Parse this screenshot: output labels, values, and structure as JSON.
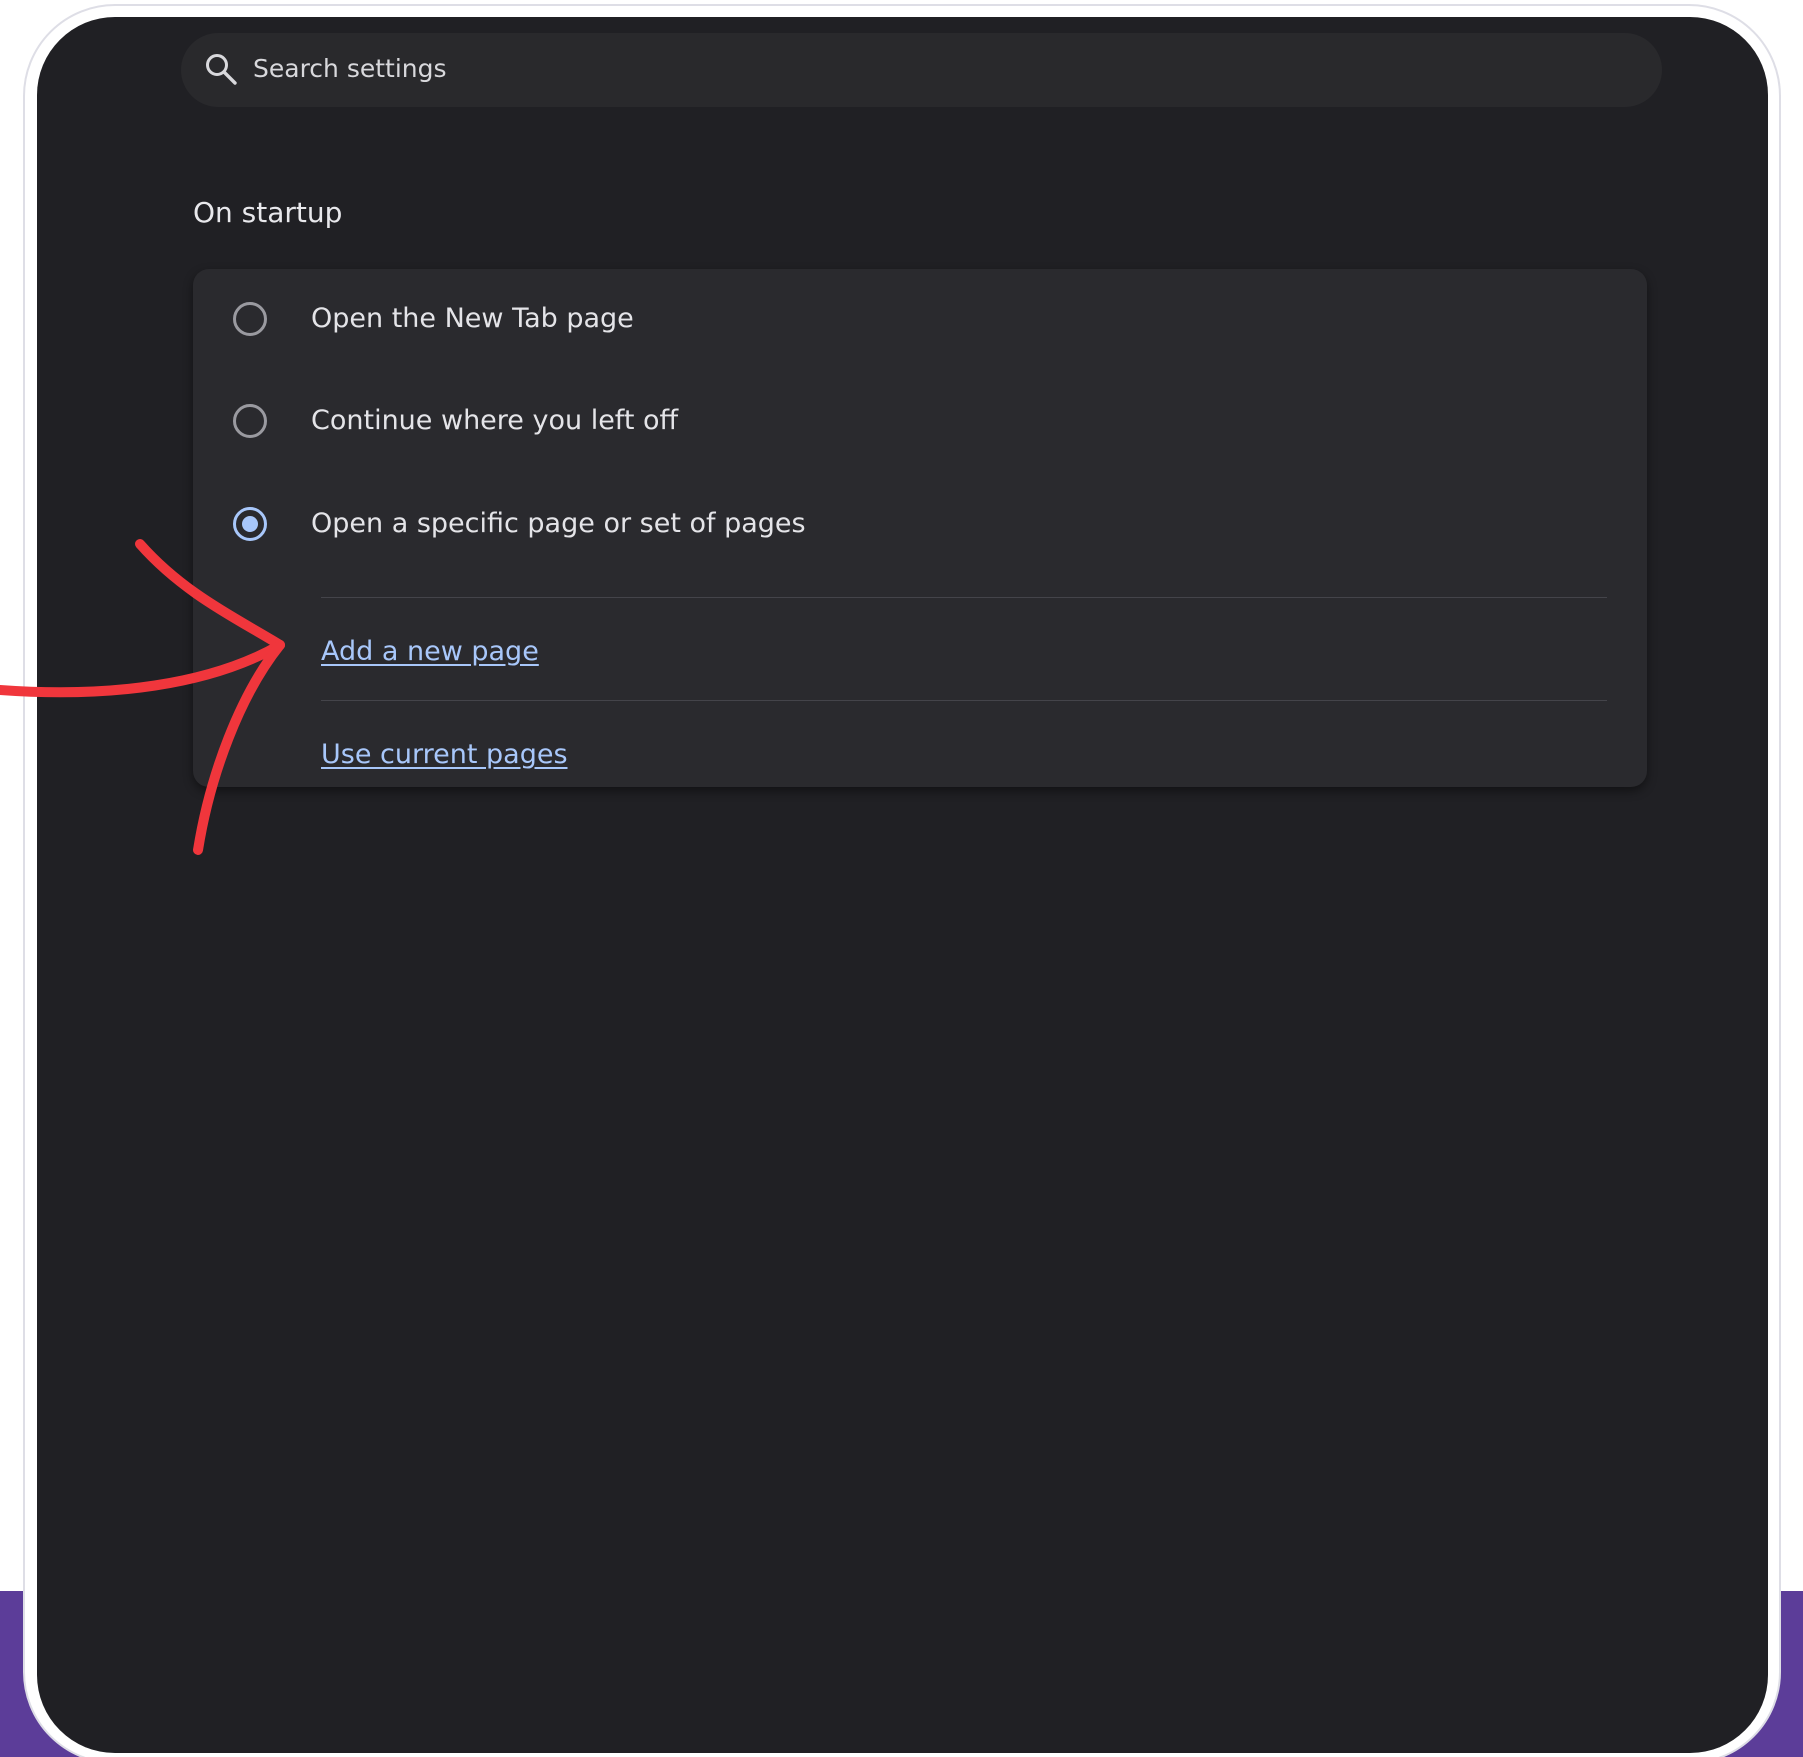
{
  "search": {
    "placeholder": "Search settings",
    "icon": "search-icon"
  },
  "startup": {
    "title": "On startup",
    "options": [
      {
        "label": "Open the New Tab page",
        "checked": false
      },
      {
        "label": "Continue where you left off",
        "checked": false
      },
      {
        "label": "Open a specific page or set of pages",
        "checked": true
      }
    ],
    "links": {
      "add_page": "Add a new page",
      "use_current": "Use current pages"
    }
  },
  "annotation": {
    "arrow_color": "#f0363c"
  },
  "colors": {
    "screen_bg": "#202024",
    "card_bg": "#2a2a2e",
    "accent": "#a8c7fa",
    "frame_band": "#5c3d99"
  }
}
